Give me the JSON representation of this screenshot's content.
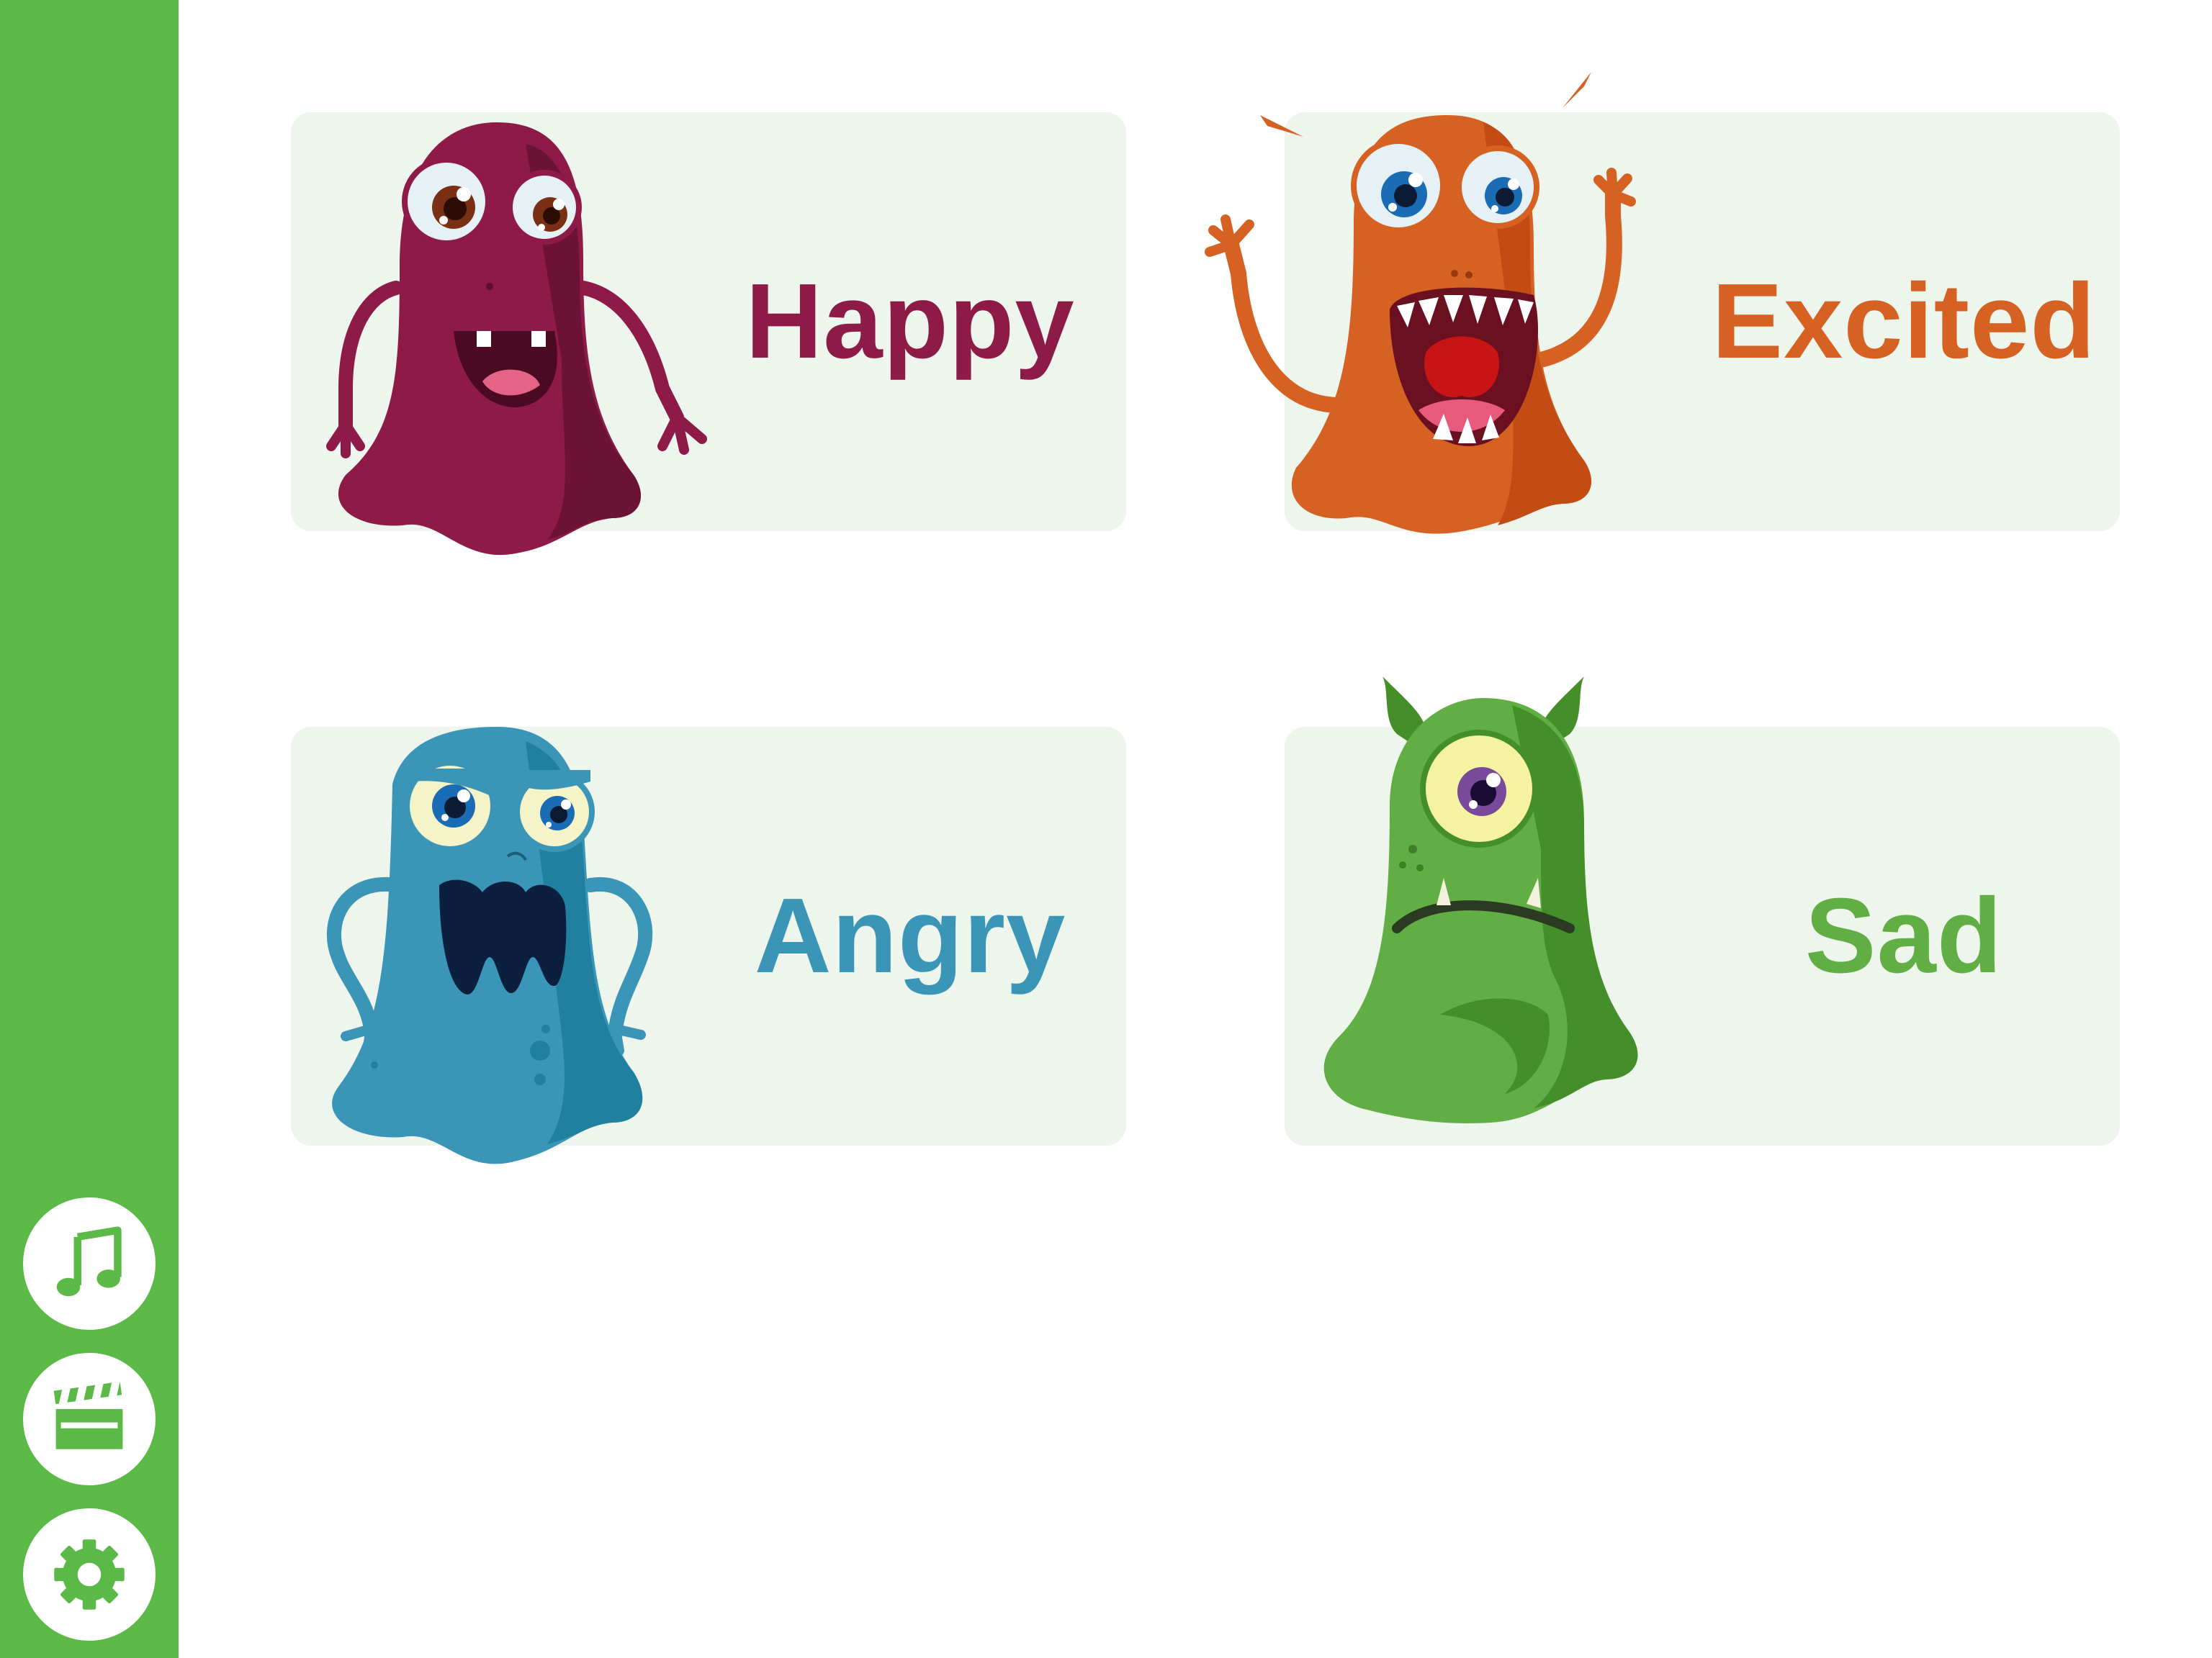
{
  "sidebar": {
    "background": "#5bba47",
    "buttons": [
      {
        "name": "music",
        "icon": "music-note-icon"
      },
      {
        "name": "video",
        "icon": "clapperboard-icon"
      },
      {
        "name": "settings",
        "icon": "gear-icon"
      }
    ]
  },
  "cards": [
    {
      "label": "Happy",
      "color": "#8e1a47",
      "monster": "happy-monster"
    },
    {
      "label": "Excited",
      "color": "#d56222",
      "monster": "excited-monster"
    },
    {
      "label": "Angry",
      "color": "#3a95b7",
      "monster": "angry-monster"
    },
    {
      "label": "Sad",
      "color": "#61ae45",
      "monster": "sad-monster"
    }
  ]
}
